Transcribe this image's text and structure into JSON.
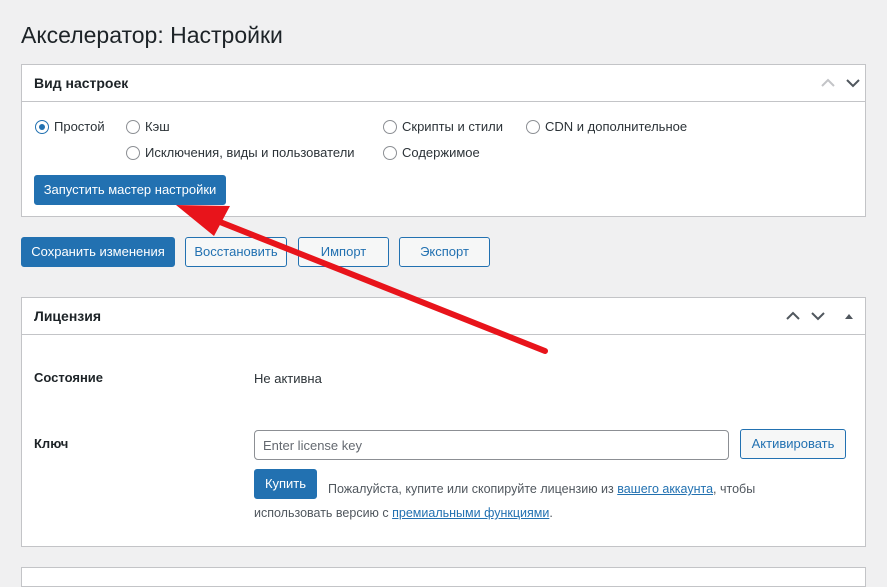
{
  "page": {
    "title": "Акселератор: Настройки"
  },
  "settings_view": {
    "title": "Вид настроек",
    "radios": [
      {
        "label": "Простой",
        "checked": true
      },
      {
        "label": "Кэш",
        "checked": false
      },
      {
        "label": "Скрипты и стили",
        "checked": false
      },
      {
        "label": "CDN и дополнительное",
        "checked": false
      },
      {
        "label": "Исключения, виды и пользователи",
        "checked": false
      },
      {
        "label": "Содержимое",
        "checked": false
      }
    ],
    "wizard_button": "Запустить мастер настройки"
  },
  "actions": {
    "save": "Сохранить изменения",
    "restore": "Восстановить",
    "import": "Импорт",
    "export": "Экспорт"
  },
  "license": {
    "title": "Лицензия",
    "status_label": "Состояние",
    "status_value": "Не активна",
    "key_label": "Ключ",
    "key_placeholder": "Enter license key",
    "activate_button": "Активировать",
    "buy_button": "Купить",
    "desc_part1": "Пожалуйста, купите или скопируйте лицензию из ",
    "desc_link1": "вашего аккаунта",
    "desc_part2": ", чтобы",
    "desc_part3": "использовать версию с ",
    "desc_link2": "премиальными функциями",
    "desc_part4": "."
  },
  "colors": {
    "primary": "#2271b1",
    "annotation_arrow": "#e8141b"
  },
  "icons": {
    "collapse_up": "chevron-up-icon",
    "collapse_down": "chevron-down-icon",
    "toggle": "triangle-up-icon"
  }
}
